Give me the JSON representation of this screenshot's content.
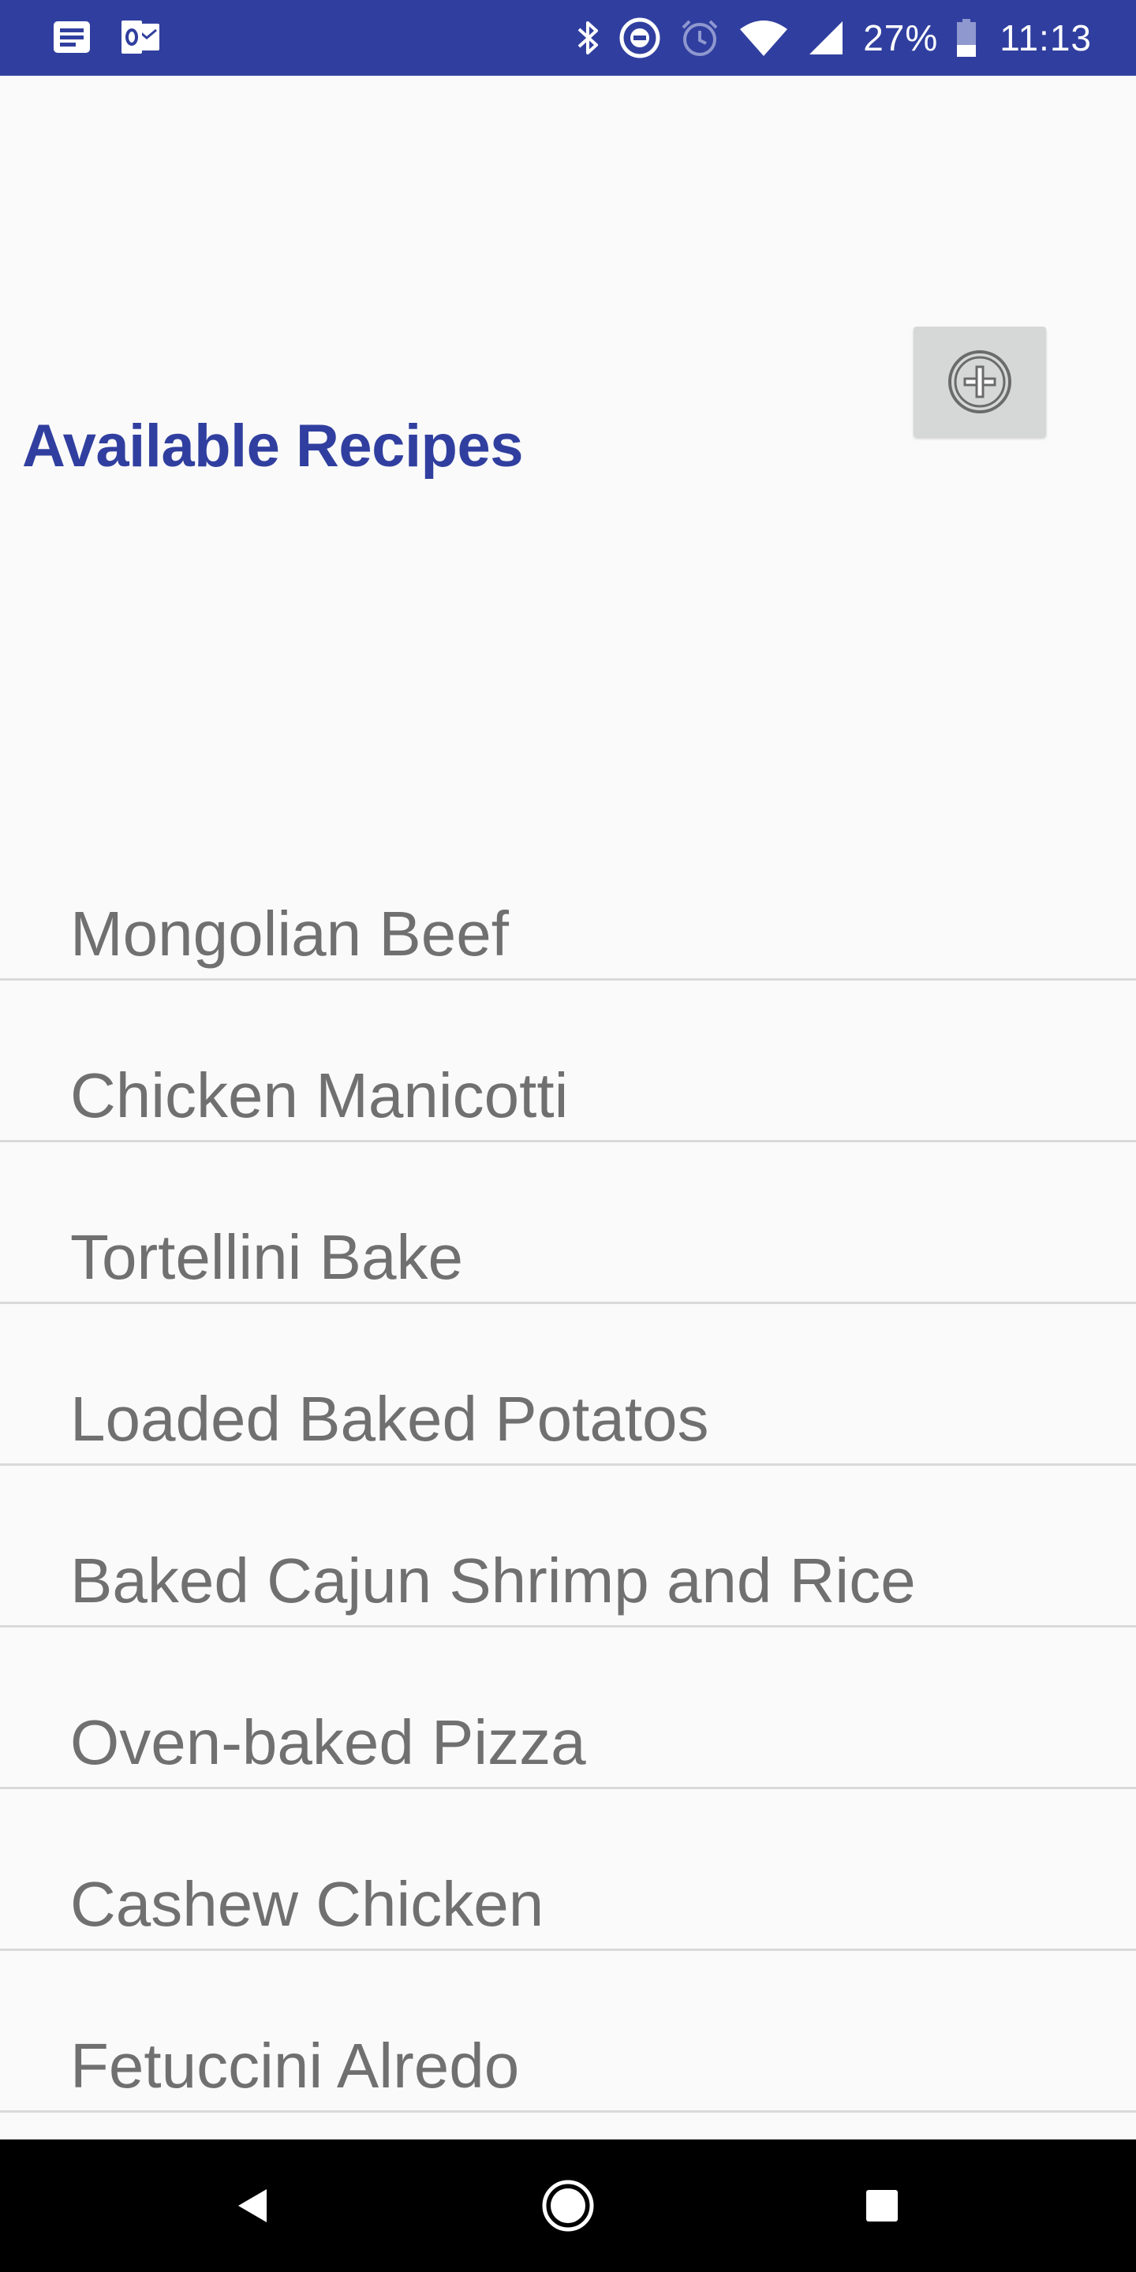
{
  "status_bar": {
    "battery": "27%",
    "time": "11:13",
    "icons_left": [
      "news-icon",
      "outlook-icon"
    ],
    "icons_right": [
      "bluetooth-icon",
      "do-not-disturb-icon",
      "alarm-icon",
      "wifi-icon",
      "signal-icon",
      "battery-icon"
    ]
  },
  "header": {
    "title": "Available Recipes",
    "add_button_icon": "add-circle-icon"
  },
  "recipes": [
    "Mongolian Beef",
    "Chicken Manicotti",
    "Tortellini Bake",
    "Loaded Baked Potatos",
    "Baked Cajun Shrimp and Rice",
    "Oven-baked Pizza",
    "Cashew Chicken",
    "Fetuccini Alredo"
  ],
  "nav_bar": {
    "icons": [
      "back-icon",
      "home-icon",
      "recents-icon"
    ]
  },
  "colors": {
    "primary_dark": "#303f9f",
    "title": "#303f9f",
    "list_text": "#707070",
    "divider": "#d9d9d9",
    "background": "#fafafa"
  }
}
